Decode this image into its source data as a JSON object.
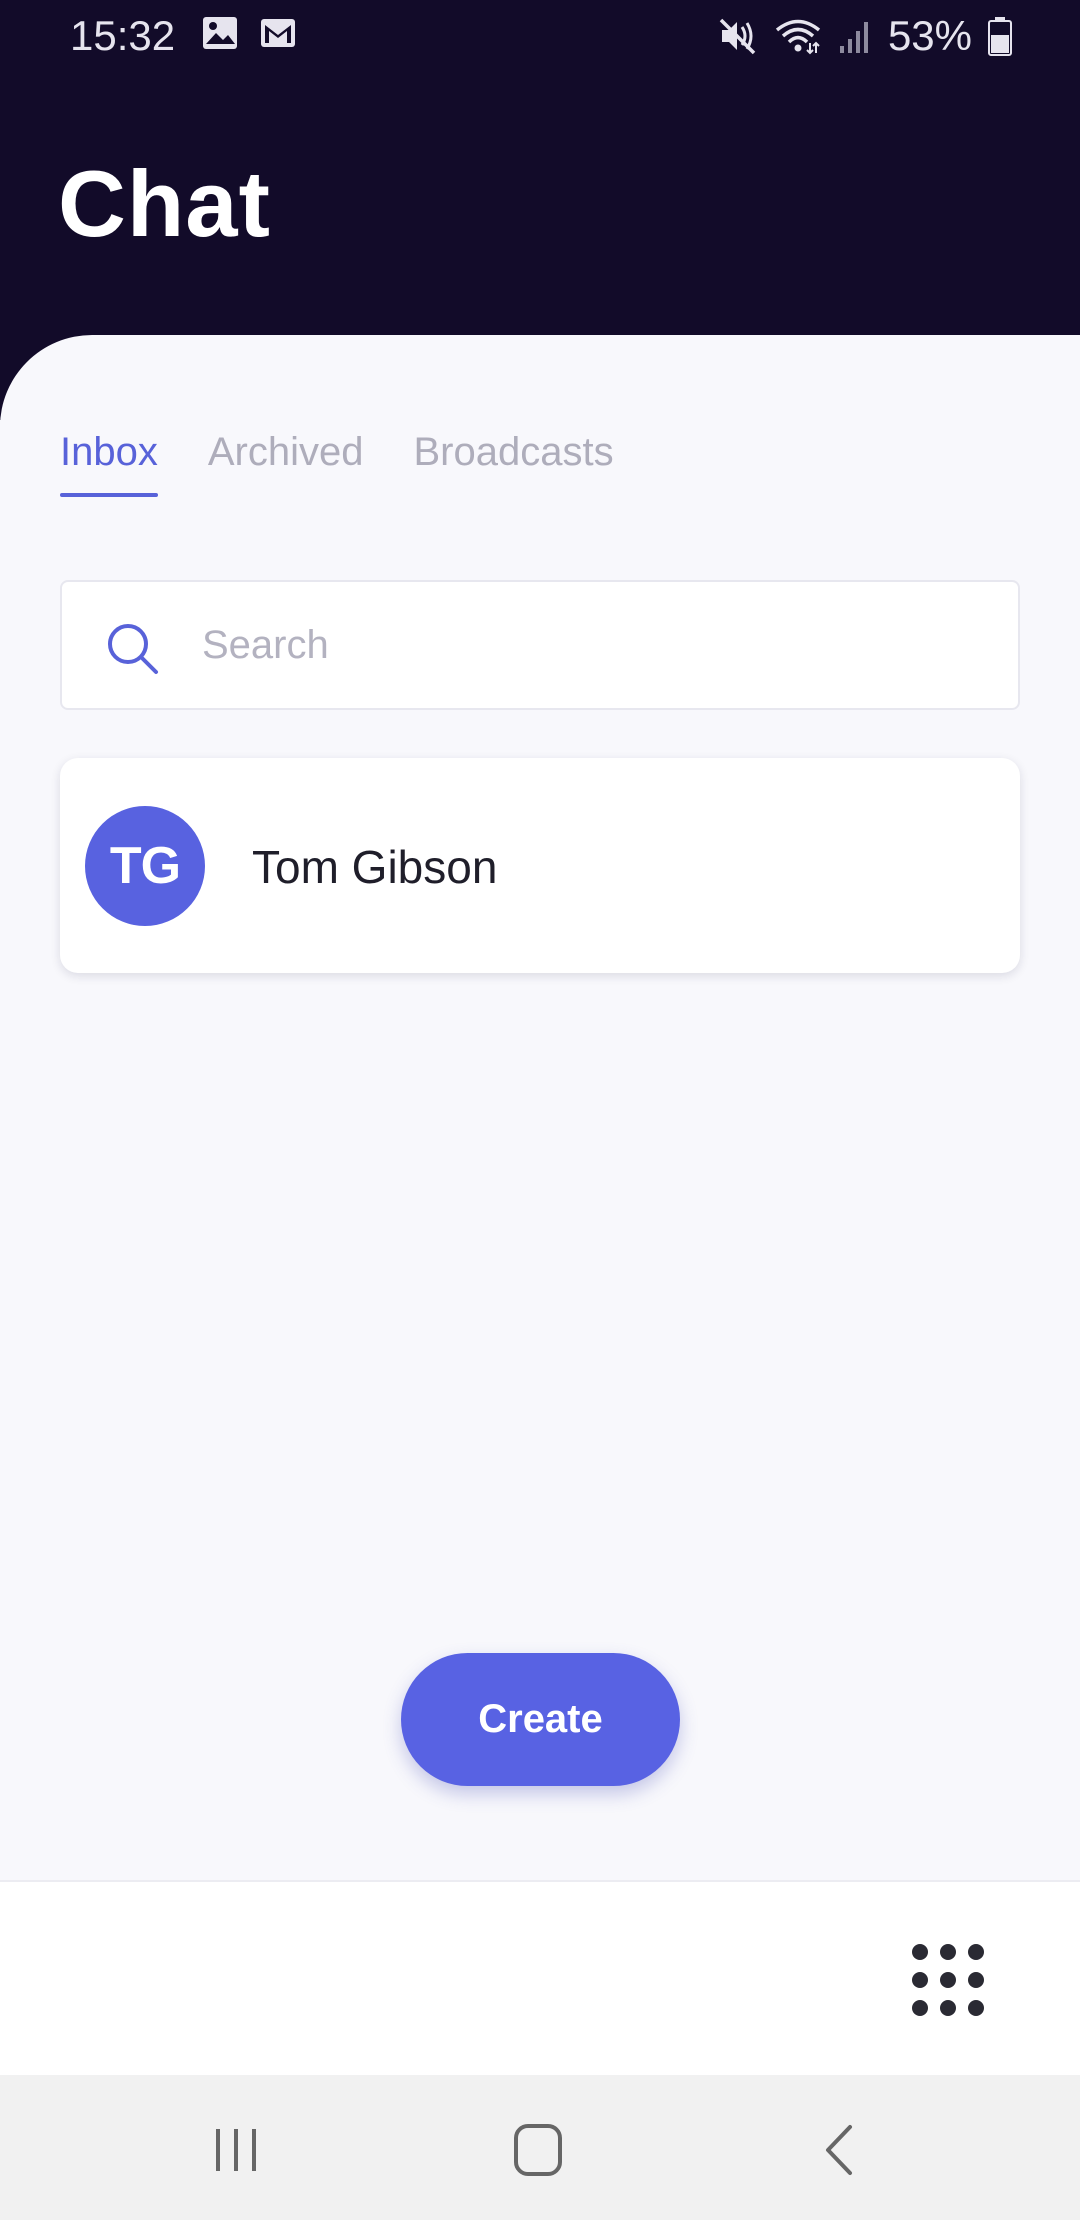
{
  "status_bar": {
    "time": "15:32",
    "battery": "53%",
    "icons": [
      "image-icon",
      "gmail-icon",
      "mute-icon",
      "wifi-icon",
      "signal-icon",
      "battery-icon"
    ]
  },
  "header": {
    "title": "Chat"
  },
  "tabs": [
    {
      "label": "Inbox",
      "active": true
    },
    {
      "label": "Archived",
      "active": false
    },
    {
      "label": "Broadcasts",
      "active": false
    }
  ],
  "search": {
    "placeholder": "Search",
    "value": ""
  },
  "chats": [
    {
      "initials": "TG",
      "name": "Tom Gibson"
    }
  ],
  "actions": {
    "create_label": "Create"
  },
  "colors": {
    "header_bg": "#120b29",
    "accent": "#5862e3",
    "page_bg": "#f8f8fc"
  }
}
